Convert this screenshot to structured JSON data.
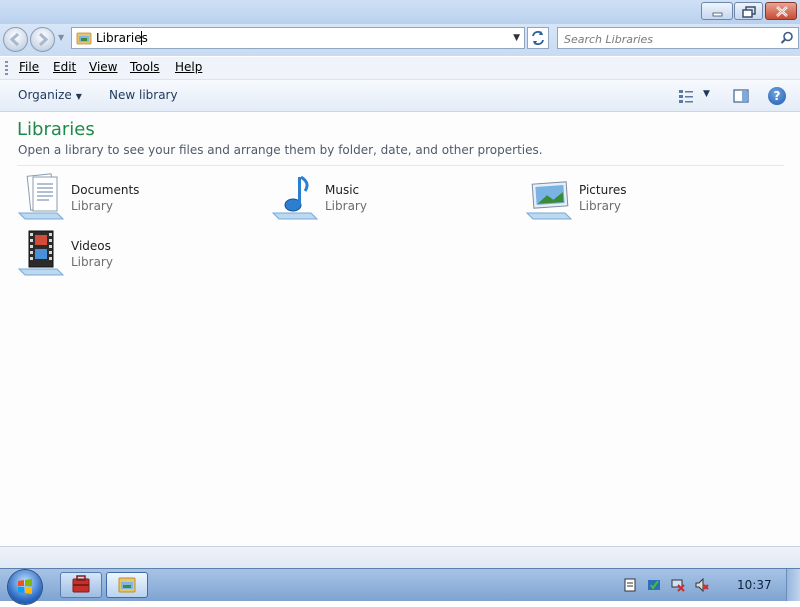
{
  "address": {
    "text": "Libraries"
  },
  "search": {
    "placeholder": "Search Libraries"
  },
  "menu": [
    {
      "label": "File"
    },
    {
      "label": "Edit"
    },
    {
      "label": "View"
    },
    {
      "label": "Tools"
    },
    {
      "label": "Help"
    }
  ],
  "toolbar": {
    "organize": "Organize",
    "new_library": "New library"
  },
  "content": {
    "title": "Libraries",
    "subtitle": "Open a library to see your files and arrange them by folder, date, and other properties."
  },
  "libraries": [
    {
      "name": "Documents",
      "type": "Library",
      "icon": "documents-library-icon"
    },
    {
      "name": "Music",
      "type": "Library",
      "icon": "music-library-icon"
    },
    {
      "name": "Pictures",
      "type": "Library",
      "icon": "pictures-library-icon"
    },
    {
      "name": "Videos",
      "type": "Library",
      "icon": "videos-library-icon"
    }
  ],
  "taskbar": {
    "clock": "10:37"
  },
  "colors": {
    "heading": "#1e8a4a",
    "accent": "#1e395b"
  }
}
